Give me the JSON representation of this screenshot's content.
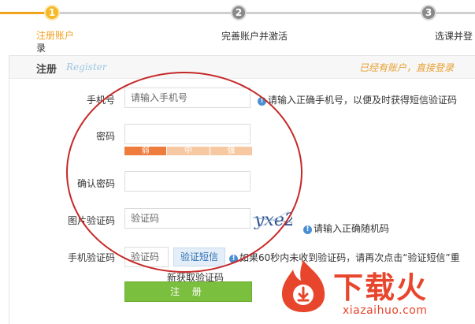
{
  "steps": [
    {
      "number": "1",
      "label": "注册账户",
      "label_tail": "录"
    },
    {
      "number": "2",
      "label": "完善账户并激活"
    },
    {
      "number": "3",
      "label": "选课并登"
    }
  ],
  "panel": {
    "title": "注册",
    "subtitle": "Register",
    "login_link": "已经有账户，直接登录"
  },
  "form": {
    "phone": {
      "label": "手机号",
      "placeholder": "请输入手机号",
      "hint": "请输入正确手机号，以便及时获得短信验证码"
    },
    "password": {
      "label": "密码",
      "placeholder": "",
      "strength": {
        "weak": "弱",
        "mid": "中",
        "strong": "强"
      }
    },
    "confirm": {
      "label": "确认密码",
      "placeholder": ""
    },
    "captcha": {
      "label": "图片验证码",
      "placeholder": "验证码",
      "image_text": "yxe2",
      "hint": "请输入正确随机码"
    },
    "sms": {
      "label": "手机验证码",
      "placeholder": "验证码",
      "button": "验证短信",
      "hint": "如果60秒内未收到验证码，请再次点击“验证短信”重",
      "hint_tail": "新获取验证码"
    },
    "submit": "注 册"
  },
  "watermark": {
    "brand": "下载火",
    "url": "xiazaihuo.com"
  },
  "colors": {
    "accent": "#f2a31c",
    "submit": "#7bbf3e",
    "annotation": "#c62828",
    "watermark": "#e8462c"
  }
}
